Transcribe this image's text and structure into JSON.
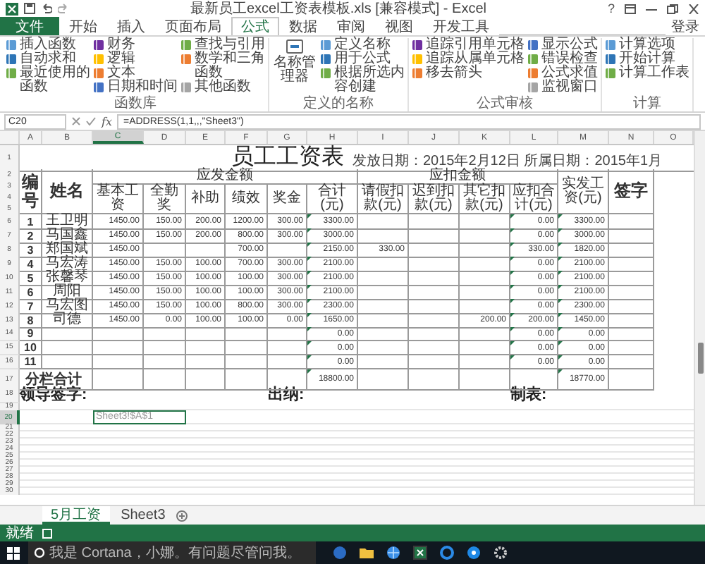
{
  "window": {
    "title": "最新员工excel工资表模板.xls [兼容模式] - Excel",
    "help": "?"
  },
  "ribbon": {
    "tabs": [
      {
        "label": "文件",
        "kind": "file",
        "selected": false
      },
      {
        "label": "开始",
        "kind": "tab",
        "selected": false
      },
      {
        "label": "插入",
        "kind": "tab",
        "selected": false
      },
      {
        "label": "页面布局",
        "kind": "tab",
        "selected": false
      },
      {
        "label": "公式",
        "kind": "tab",
        "selected": true
      },
      {
        "label": "数据",
        "kind": "tab",
        "selected": false
      },
      {
        "label": "审阅",
        "kind": "tab",
        "selected": false
      },
      {
        "label": "视图",
        "kind": "tab",
        "selected": false
      },
      {
        "label": "开发工具",
        "kind": "tab",
        "selected": false
      }
    ],
    "account": "登录",
    "groups": [
      {
        "label": "函数库",
        "columns": [
          [
            "插入函数",
            "自动求和",
            "最近使用的函数"
          ],
          [
            "财务",
            "逻辑",
            "文本",
            "日期和时间"
          ],
          [
            "查找与引用",
            "数学和三角函数",
            "其他函数"
          ]
        ]
      },
      {
        "label": "定义的名称",
        "large_button": "名称管理器",
        "columns": [
          [
            "定义名称",
            "用于公式",
            "根据所选内容创建"
          ]
        ]
      },
      {
        "label": "公式审核",
        "columns": [
          [
            "追踪引用单元格",
            "追踪从属单元格",
            "移去箭头"
          ],
          [
            "显示公式",
            "错误检查",
            "公式求值",
            "监视窗口"
          ]
        ]
      },
      {
        "label": "计算",
        "columns": [
          [
            "计算选项",
            "开始计算",
            "计算工作表"
          ]
        ]
      }
    ]
  },
  "formula_bar": {
    "name_box": "C20",
    "function_label": "fx",
    "formula": "=ADDRESS(1,1,,,\"Sheet3\")"
  },
  "sheet": {
    "columns": [
      {
        "label": "A",
        "selected": false
      },
      {
        "label": "B",
        "selected": false
      },
      {
        "label": "C",
        "selected": true
      },
      {
        "label": "D",
        "selected": false
      },
      {
        "label": "E",
        "selected": false
      },
      {
        "label": "F",
        "selected": false
      },
      {
        "label": "G",
        "selected": false
      },
      {
        "label": "H",
        "selected": false
      },
      {
        "label": "I",
        "selected": false
      },
      {
        "label": "J",
        "selected": false
      },
      {
        "label": "K",
        "selected": false
      },
      {
        "label": "L",
        "selected": false
      },
      {
        "label": "M",
        "selected": false
      },
      {
        "label": "N",
        "selected": false
      },
      {
        "label": "O",
        "selected": false
      }
    ],
    "title_row": "1",
    "title": "员工工资表",
    "subtitle": "发放日期：2015年2月12日 所属日期：2015年1月",
    "header_rows": [
      "2",
      "3",
      "4",
      "5"
    ],
    "header": {
      "number": "编号",
      "name": "姓名",
      "groups": [
        {
          "label": "应发金额",
          "columns": [
            "基本工资",
            "全勤奖",
            "补助",
            "绩效",
            "奖金",
            "合计(元)"
          ]
        },
        {
          "label": "应扣金额",
          "columns": [
            "请假扣款(元)",
            "迟到扣款(元)",
            "其它扣款(元)",
            "应扣合计(元)"
          ]
        }
      ],
      "net": "实发工资(元)",
      "sign": "签字"
    },
    "rows": [
      {
        "row": "6",
        "cells": [
          "1",
          "王卫明",
          "1450.00",
          "150.00",
          "200.00",
          "1200.00",
          "300.00",
          "3300.00",
          null,
          null,
          null,
          "0.00",
          "3300.00",
          null
        ]
      },
      {
        "row": "7",
        "cells": [
          "2",
          "马国鑫",
          "1450.00",
          "150.00",
          "200.00",
          "800.00",
          "300.00",
          "3000.00",
          null,
          null,
          null,
          "0.00",
          "3000.00",
          null
        ]
      },
      {
        "row": "8",
        "cells": [
          "3",
          "郑国斌",
          "1450.00",
          null,
          null,
          "700.00",
          null,
          "2150.00",
          "330.00",
          null,
          null,
          "330.00",
          "1820.00",
          null
        ]
      },
      {
        "row": "9",
        "cells": [
          "4",
          "马宏涛",
          "1450.00",
          "150.00",
          "100.00",
          "700.00",
          "300.00",
          "2100.00",
          null,
          null,
          null,
          "0.00",
          "2100.00",
          null
        ]
      },
      {
        "row": "10",
        "cells": [
          "5",
          "张馨琴",
          "1450.00",
          "150.00",
          "100.00",
          "100.00",
          "300.00",
          "2100.00",
          null,
          null,
          null,
          "0.00",
          "2100.00",
          null
        ]
      },
      {
        "row": "11",
        "cells": [
          "6",
          "周阳",
          "1450.00",
          "150.00",
          "100.00",
          "100.00",
          "300.00",
          "2100.00",
          null,
          null,
          null,
          "0.00",
          "2100.00",
          null
        ]
      },
      {
        "row": "12",
        "cells": [
          "7",
          "马宏图",
          "1450.00",
          "150.00",
          "100.00",
          "800.00",
          "300.00",
          "2300.00",
          null,
          null,
          null,
          "0.00",
          "2300.00",
          null
        ]
      },
      {
        "row": "13",
        "cells": [
          "8",
          "司德",
          "1450.00",
          "0.00",
          "100.00",
          "100.00",
          "0.00",
          "1650.00",
          null,
          null,
          "200.00",
          "200.00",
          "1450.00",
          null
        ]
      },
      {
        "row": "14",
        "cells": [
          "9",
          null,
          null,
          null,
          null,
          null,
          null,
          "0.00",
          null,
          null,
          null,
          "0.00",
          "0.00",
          null
        ]
      },
      {
        "row": "15",
        "cells": [
          "10",
          null,
          null,
          null,
          null,
          null,
          null,
          "0.00",
          null,
          null,
          null,
          "0.00",
          "0.00",
          null
        ]
      },
      {
        "row": "16",
        "cells": [
          "11",
          null,
          null,
          null,
          null,
          null,
          null,
          "0.00",
          null,
          null,
          null,
          "0.00",
          "0.00",
          null
        ]
      }
    ],
    "total": {
      "row": "17",
      "label": "分栏合计",
      "gross": "18800.00",
      "net": "18770.00"
    },
    "signatures": {
      "row": "18",
      "items": [
        "领导签字:",
        "出纳:",
        "制表:"
      ]
    },
    "blank_rows_before": [
      "19"
    ],
    "active_cell": {
      "row": "20",
      "value": "Sheet3!$A$1"
    },
    "blank_rows_after": [
      "21",
      "22",
      "23",
      "24",
      "25",
      "26",
      "27",
      "28",
      "29",
      "30"
    ]
  },
  "sheet_tabs": [
    {
      "label": "5月工资",
      "selected": true
    },
    {
      "label": "Sheet3",
      "selected": false
    }
  ],
  "status_bar": {
    "text": "就绪"
  },
  "taskbar": {
    "search_placeholder": "我是 Cortana，小娜。有问题尽管问我。"
  }
}
